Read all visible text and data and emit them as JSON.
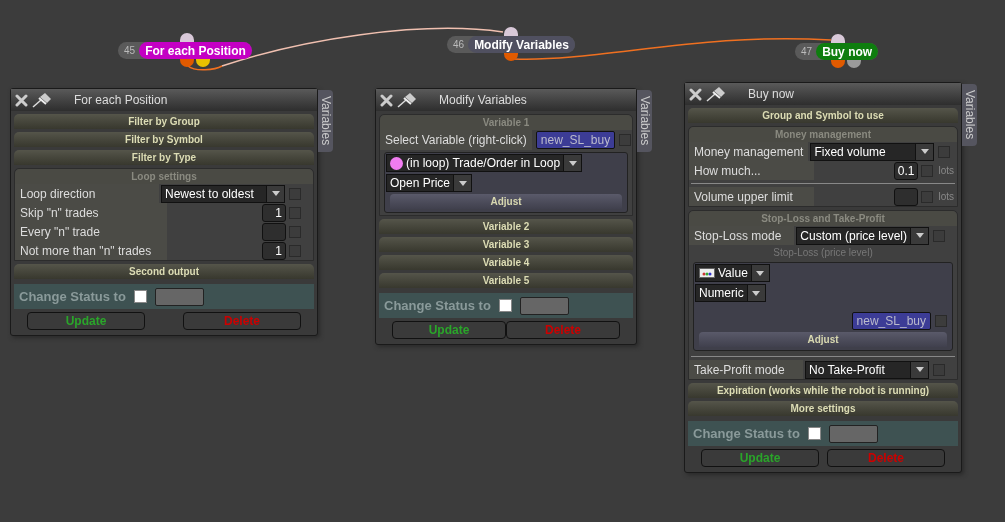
{
  "nodes": [
    {
      "number": "45",
      "label": "For each Position",
      "color": "#c400c4",
      "outputs": [
        {
          "kind": "main"
        },
        {
          "kind": "second"
        }
      ]
    },
    {
      "number": "46",
      "label": "Modify Variables",
      "color": "#505060",
      "outputs": [
        {
          "kind": "main"
        }
      ]
    },
    {
      "number": "47",
      "label": "Buy now",
      "color": "#0e7d0e",
      "outputs": [
        {
          "kind": "main"
        },
        {
          "kind": "inactive"
        }
      ]
    }
  ],
  "panels": [
    {
      "title": "For each Position",
      "side_tab": "Variables",
      "blocks": [
        {
          "kind": "header",
          "label": "Filter by Group"
        },
        {
          "kind": "header",
          "label": "Filter by Symbol"
        },
        {
          "kind": "header",
          "label": "Filter by Type"
        },
        {
          "kind": "group",
          "label": "Loop settings",
          "items": [
            {
              "kind": "select",
              "label": "Loop direction",
              "value": "Newest to oldest",
              "checked": false
            },
            {
              "kind": "number",
              "label": "Skip \"n\" trades",
              "value": "1",
              "checked": false
            },
            {
              "kind": "number",
              "label": "Every \"n\" trade",
              "checked": false
            },
            {
              "kind": "number",
              "label": "Not more than \"n\" trades",
              "value": "1",
              "checked": false
            }
          ]
        },
        {
          "kind": "header",
          "label": "Second output"
        },
        {
          "kind": "status",
          "label": "Change Status to",
          "checked": false
        }
      ],
      "buttons": [
        {
          "label": "Update",
          "kind": "update"
        },
        {
          "label": "Delete",
          "kind": "delete"
        }
      ]
    },
    {
      "title": "Modify Variables",
      "side_tab": "Variables",
      "blocks": [
        {
          "kind": "group",
          "label": "Variable 1",
          "items": [
            {
              "kind": "variable",
              "label": "Select Variable (right-click)",
              "value": "new_SL_buy",
              "checked": false
            },
            {
              "kind": "subbox",
              "items": [
                {
                  "kind": "dot-select",
                  "value": "(in loop) Trade/Order in Loop"
                },
                {
                  "kind": "select",
                  "value": "Open Price"
                },
                {
                  "kind": "adjust",
                  "label": "Adjust"
                }
              ]
            }
          ]
        },
        {
          "kind": "header",
          "label": "Variable 2"
        },
        {
          "kind": "header",
          "label": "Variable 3"
        },
        {
          "kind": "header",
          "label": "Variable 4"
        },
        {
          "kind": "header",
          "label": "Variable 5"
        },
        {
          "kind": "status",
          "label": "Change Status to",
          "checked": false
        }
      ],
      "buttons": [
        {
          "label": "Update",
          "kind": "update"
        },
        {
          "label": "Delete",
          "kind": "delete"
        }
      ]
    },
    {
      "title": "Buy now",
      "side_tab": "Variables",
      "blocks": [
        {
          "kind": "header",
          "label": "Group and Symbol to use"
        },
        {
          "kind": "group",
          "label": "Money management",
          "items": [
            {
              "kind": "select",
              "label": "Money management",
              "value": "Fixed volume",
              "checked": false
            },
            {
              "kind": "number",
              "label": "How much...",
              "value": "0.1",
              "unit": "lots",
              "checked": false
            },
            {
              "kind": "divider"
            },
            {
              "kind": "number",
              "label": "Volume upper limit",
              "unit": "lots",
              "checked": false
            }
          ]
        },
        {
          "kind": "group",
          "label": "Stop-Loss and Take-Profit",
          "items": [
            {
              "kind": "select",
              "label": "Stop-Loss mode",
              "value": "Custom (price level)",
              "checked": false
            },
            {
              "kind": "caption",
              "label": "Stop-Loss (price level)"
            },
            {
              "kind": "subbox",
              "items": [
                {
                  "kind": "value-select",
                  "value": "Value"
                },
                {
                  "kind": "select",
                  "value": "Numeric"
                },
                {
                  "kind": "chip",
                  "value": "new_SL_buy",
                  "checked": false
                },
                {
                  "kind": "adjust",
                  "label": "Adjust"
                }
              ]
            },
            {
              "kind": "divider"
            },
            {
              "kind": "select",
              "label": "Take-Profit mode",
              "value": "No Take-Profit",
              "checked": false
            }
          ]
        },
        {
          "kind": "header",
          "label": "Expiration (works while the robot is running)"
        },
        {
          "kind": "header",
          "label": "More settings"
        },
        {
          "kind": "status",
          "label": "Change Status to",
          "checked": false
        }
      ],
      "buttons": [
        {
          "label": "Update",
          "kind": "update"
        },
        {
          "label": "Delete",
          "kind": "delete"
        }
      ]
    }
  ]
}
